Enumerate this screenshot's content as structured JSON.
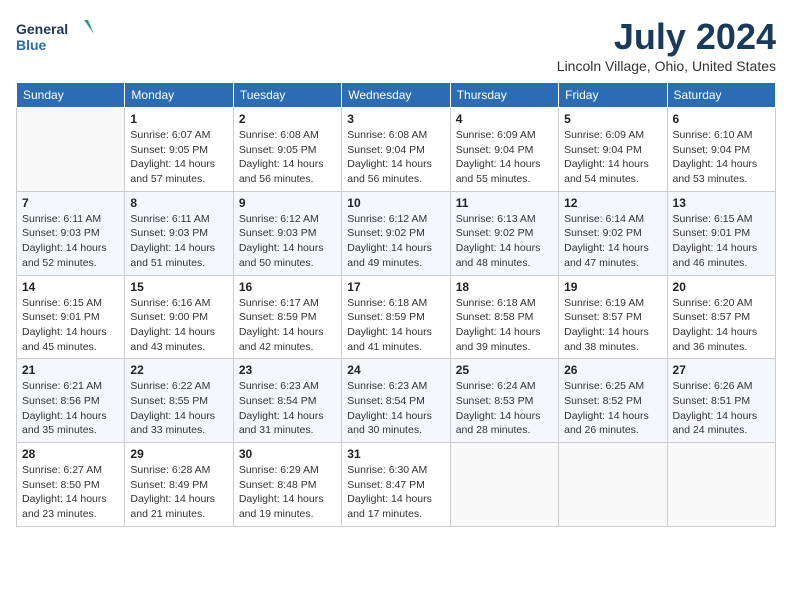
{
  "header": {
    "logo_line1": "General",
    "logo_line2": "Blue",
    "month": "July 2024",
    "location": "Lincoln Village, Ohio, United States"
  },
  "days_of_week": [
    "Sunday",
    "Monday",
    "Tuesday",
    "Wednesday",
    "Thursday",
    "Friday",
    "Saturday"
  ],
  "weeks": [
    [
      {
        "day": "",
        "info": ""
      },
      {
        "day": "1",
        "info": "Sunrise: 6:07 AM\nSunset: 9:05 PM\nDaylight: 14 hours\nand 57 minutes."
      },
      {
        "day": "2",
        "info": "Sunrise: 6:08 AM\nSunset: 9:05 PM\nDaylight: 14 hours\nand 56 minutes."
      },
      {
        "day": "3",
        "info": "Sunrise: 6:08 AM\nSunset: 9:04 PM\nDaylight: 14 hours\nand 56 minutes."
      },
      {
        "day": "4",
        "info": "Sunrise: 6:09 AM\nSunset: 9:04 PM\nDaylight: 14 hours\nand 55 minutes."
      },
      {
        "day": "5",
        "info": "Sunrise: 6:09 AM\nSunset: 9:04 PM\nDaylight: 14 hours\nand 54 minutes."
      },
      {
        "day": "6",
        "info": "Sunrise: 6:10 AM\nSunset: 9:04 PM\nDaylight: 14 hours\nand 53 minutes."
      }
    ],
    [
      {
        "day": "7",
        "info": "Sunrise: 6:11 AM\nSunset: 9:03 PM\nDaylight: 14 hours\nand 52 minutes."
      },
      {
        "day": "8",
        "info": "Sunrise: 6:11 AM\nSunset: 9:03 PM\nDaylight: 14 hours\nand 51 minutes."
      },
      {
        "day": "9",
        "info": "Sunrise: 6:12 AM\nSunset: 9:03 PM\nDaylight: 14 hours\nand 50 minutes."
      },
      {
        "day": "10",
        "info": "Sunrise: 6:12 AM\nSunset: 9:02 PM\nDaylight: 14 hours\nand 49 minutes."
      },
      {
        "day": "11",
        "info": "Sunrise: 6:13 AM\nSunset: 9:02 PM\nDaylight: 14 hours\nand 48 minutes."
      },
      {
        "day": "12",
        "info": "Sunrise: 6:14 AM\nSunset: 9:02 PM\nDaylight: 14 hours\nand 47 minutes."
      },
      {
        "day": "13",
        "info": "Sunrise: 6:15 AM\nSunset: 9:01 PM\nDaylight: 14 hours\nand 46 minutes."
      }
    ],
    [
      {
        "day": "14",
        "info": "Sunrise: 6:15 AM\nSunset: 9:01 PM\nDaylight: 14 hours\nand 45 minutes."
      },
      {
        "day": "15",
        "info": "Sunrise: 6:16 AM\nSunset: 9:00 PM\nDaylight: 14 hours\nand 43 minutes."
      },
      {
        "day": "16",
        "info": "Sunrise: 6:17 AM\nSunset: 8:59 PM\nDaylight: 14 hours\nand 42 minutes."
      },
      {
        "day": "17",
        "info": "Sunrise: 6:18 AM\nSunset: 8:59 PM\nDaylight: 14 hours\nand 41 minutes."
      },
      {
        "day": "18",
        "info": "Sunrise: 6:18 AM\nSunset: 8:58 PM\nDaylight: 14 hours\nand 39 minutes."
      },
      {
        "day": "19",
        "info": "Sunrise: 6:19 AM\nSunset: 8:57 PM\nDaylight: 14 hours\nand 38 minutes."
      },
      {
        "day": "20",
        "info": "Sunrise: 6:20 AM\nSunset: 8:57 PM\nDaylight: 14 hours\nand 36 minutes."
      }
    ],
    [
      {
        "day": "21",
        "info": "Sunrise: 6:21 AM\nSunset: 8:56 PM\nDaylight: 14 hours\nand 35 minutes."
      },
      {
        "day": "22",
        "info": "Sunrise: 6:22 AM\nSunset: 8:55 PM\nDaylight: 14 hours\nand 33 minutes."
      },
      {
        "day": "23",
        "info": "Sunrise: 6:23 AM\nSunset: 8:54 PM\nDaylight: 14 hours\nand 31 minutes."
      },
      {
        "day": "24",
        "info": "Sunrise: 6:23 AM\nSunset: 8:54 PM\nDaylight: 14 hours\nand 30 minutes."
      },
      {
        "day": "25",
        "info": "Sunrise: 6:24 AM\nSunset: 8:53 PM\nDaylight: 14 hours\nand 28 minutes."
      },
      {
        "day": "26",
        "info": "Sunrise: 6:25 AM\nSunset: 8:52 PM\nDaylight: 14 hours\nand 26 minutes."
      },
      {
        "day": "27",
        "info": "Sunrise: 6:26 AM\nSunset: 8:51 PM\nDaylight: 14 hours\nand 24 minutes."
      }
    ],
    [
      {
        "day": "28",
        "info": "Sunrise: 6:27 AM\nSunset: 8:50 PM\nDaylight: 14 hours\nand 23 minutes."
      },
      {
        "day": "29",
        "info": "Sunrise: 6:28 AM\nSunset: 8:49 PM\nDaylight: 14 hours\nand 21 minutes."
      },
      {
        "day": "30",
        "info": "Sunrise: 6:29 AM\nSunset: 8:48 PM\nDaylight: 14 hours\nand 19 minutes."
      },
      {
        "day": "31",
        "info": "Sunrise: 6:30 AM\nSunset: 8:47 PM\nDaylight: 14 hours\nand 17 minutes."
      },
      {
        "day": "",
        "info": ""
      },
      {
        "day": "",
        "info": ""
      },
      {
        "day": "",
        "info": ""
      }
    ]
  ]
}
